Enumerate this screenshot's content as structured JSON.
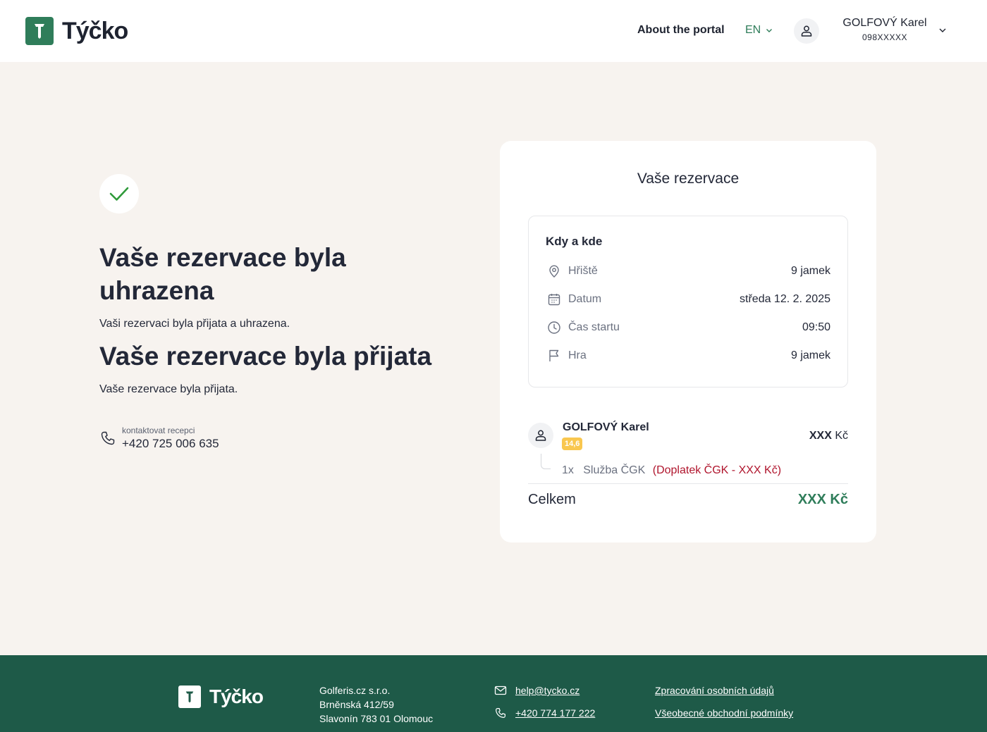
{
  "brand": {
    "name": "Týčko",
    "primary_color": "#2f7d5a",
    "footer_color": "#1e5a48"
  },
  "header": {
    "about_label": "About the portal",
    "language": "EN",
    "user_name": "GOLFOVÝ Karel",
    "user_id": "098XXXXX"
  },
  "confirmation": {
    "paid_title": "Vaše rezervace byla uhrazena",
    "paid_subtitle": "Vaši rezervaci byla přijata a uhrazena.",
    "accepted_title": "Vaše rezervace byla přijata",
    "accepted_subtitle": "Vaše rezervace byla přijata.",
    "contact_label": "kontaktovat recepci",
    "contact_phone": "+420 725 006 635"
  },
  "reservation": {
    "title": "Vaše rezervace",
    "section_title": "Kdy a kde",
    "rows": [
      {
        "icon": "map-pin-icon",
        "label": "Hřiště",
        "value": "9 jamek"
      },
      {
        "icon": "calendar-icon",
        "label": "Datum",
        "value": "středa 12. 2. 2025"
      },
      {
        "icon": "clock-icon",
        "label": "Čas startu",
        "value": "09:50"
      },
      {
        "icon": "flag-icon",
        "label": "Hra",
        "value": "9 jamek"
      }
    ],
    "player": {
      "name": "GOLFOVÝ Karel",
      "handicap": "14,6",
      "price_amount": "XXX",
      "price_currency": "Kč"
    },
    "service": {
      "quantity": "1x",
      "name": "Služba ČGK",
      "surcharge": "(Doplatek ČGK - XXX Kč)"
    },
    "total_label": "Celkem",
    "total_value": "XXX Kč"
  },
  "footer": {
    "address_lines": [
      "Golferis.cz s.r.o.",
      "Brněnská 412/59",
      "Slavonín 783 01 Olomouc"
    ],
    "email": "help@tycko.cz",
    "phone": "+420 774 177 222",
    "privacy_link": "Zpracování osobních údajů",
    "terms_link": "Všeobecné obchodní podmínky"
  }
}
